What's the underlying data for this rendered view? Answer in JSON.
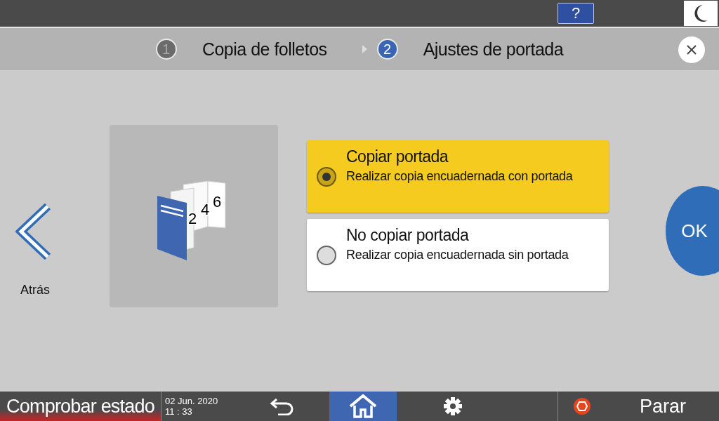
{
  "steps": [
    {
      "number": "1",
      "label": "Copia de folletos",
      "selected": false
    },
    {
      "number": "2",
      "label": "Ajustes de portada",
      "selected": true
    }
  ],
  "help_button": "?",
  "back": {
    "label": "Atrás"
  },
  "illustration": {
    "page_numbers": [
      "2",
      "4",
      "6"
    ]
  },
  "options": [
    {
      "title": "Copiar portada",
      "description": "Realizar copia encuadernada con portada",
      "selected": true
    },
    {
      "title": "No copiar portada",
      "description": "Realizar copia encuadernada sin portada",
      "selected": false
    }
  ],
  "ok_button": "OK",
  "status_bar": {
    "check_status": "Comprobar estado",
    "date": "02 Jun. 2020",
    "time": "11 : 33",
    "stop": "Parar"
  }
}
